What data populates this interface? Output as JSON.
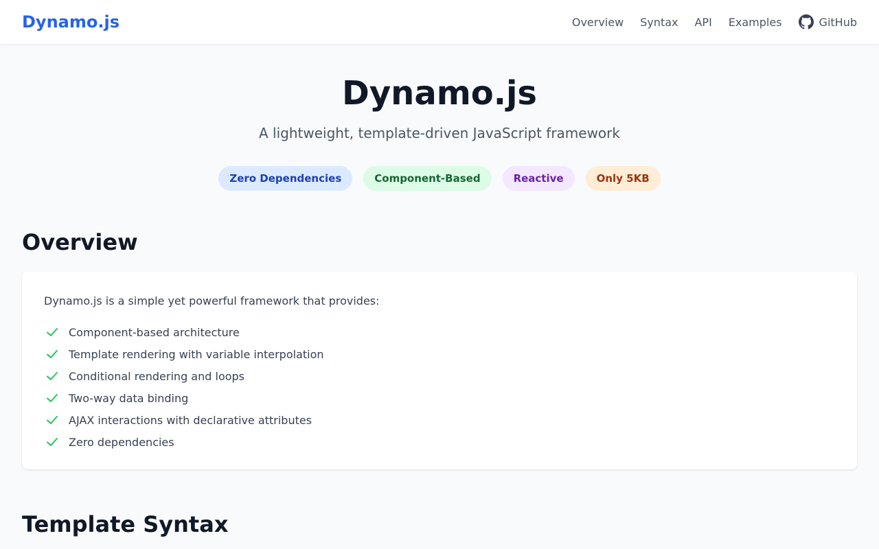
{
  "header": {
    "brand": "Dynamo.js",
    "nav": [
      {
        "label": "Overview"
      },
      {
        "label": "Syntax"
      },
      {
        "label": "API"
      },
      {
        "label": "Examples"
      },
      {
        "label": "GitHub",
        "icon": "github-icon"
      }
    ]
  },
  "hero": {
    "title": "Dynamo.js",
    "tagline": "A lightweight, template-driven JavaScript framework",
    "badges": [
      {
        "label": "Zero Dependencies",
        "color": "#dbeafe"
      },
      {
        "label": "Component-Based",
        "color": "#dcfce7"
      },
      {
        "label": "Reactive",
        "color": "#f3e8ff"
      },
      {
        "label": "Only 5KB",
        "color": "#ffedd5"
      }
    ]
  },
  "overview": {
    "title": "Overview",
    "intro": "Dynamo.js is a simple yet powerful framework that provides:",
    "features": [
      "Component-based architecture",
      "Template rendering with variable interpolation",
      "Conditional rendering and loops",
      "Two-way data binding",
      "AJAX interactions with declarative attributes",
      "Zero dependencies"
    ],
    "check_icon": "check-icon",
    "check_color": "#22c55e"
  },
  "syntax": {
    "title": "Template Syntax"
  },
  "colors": {
    "brand": "#2563eb",
    "background": "#f8fafc"
  }
}
